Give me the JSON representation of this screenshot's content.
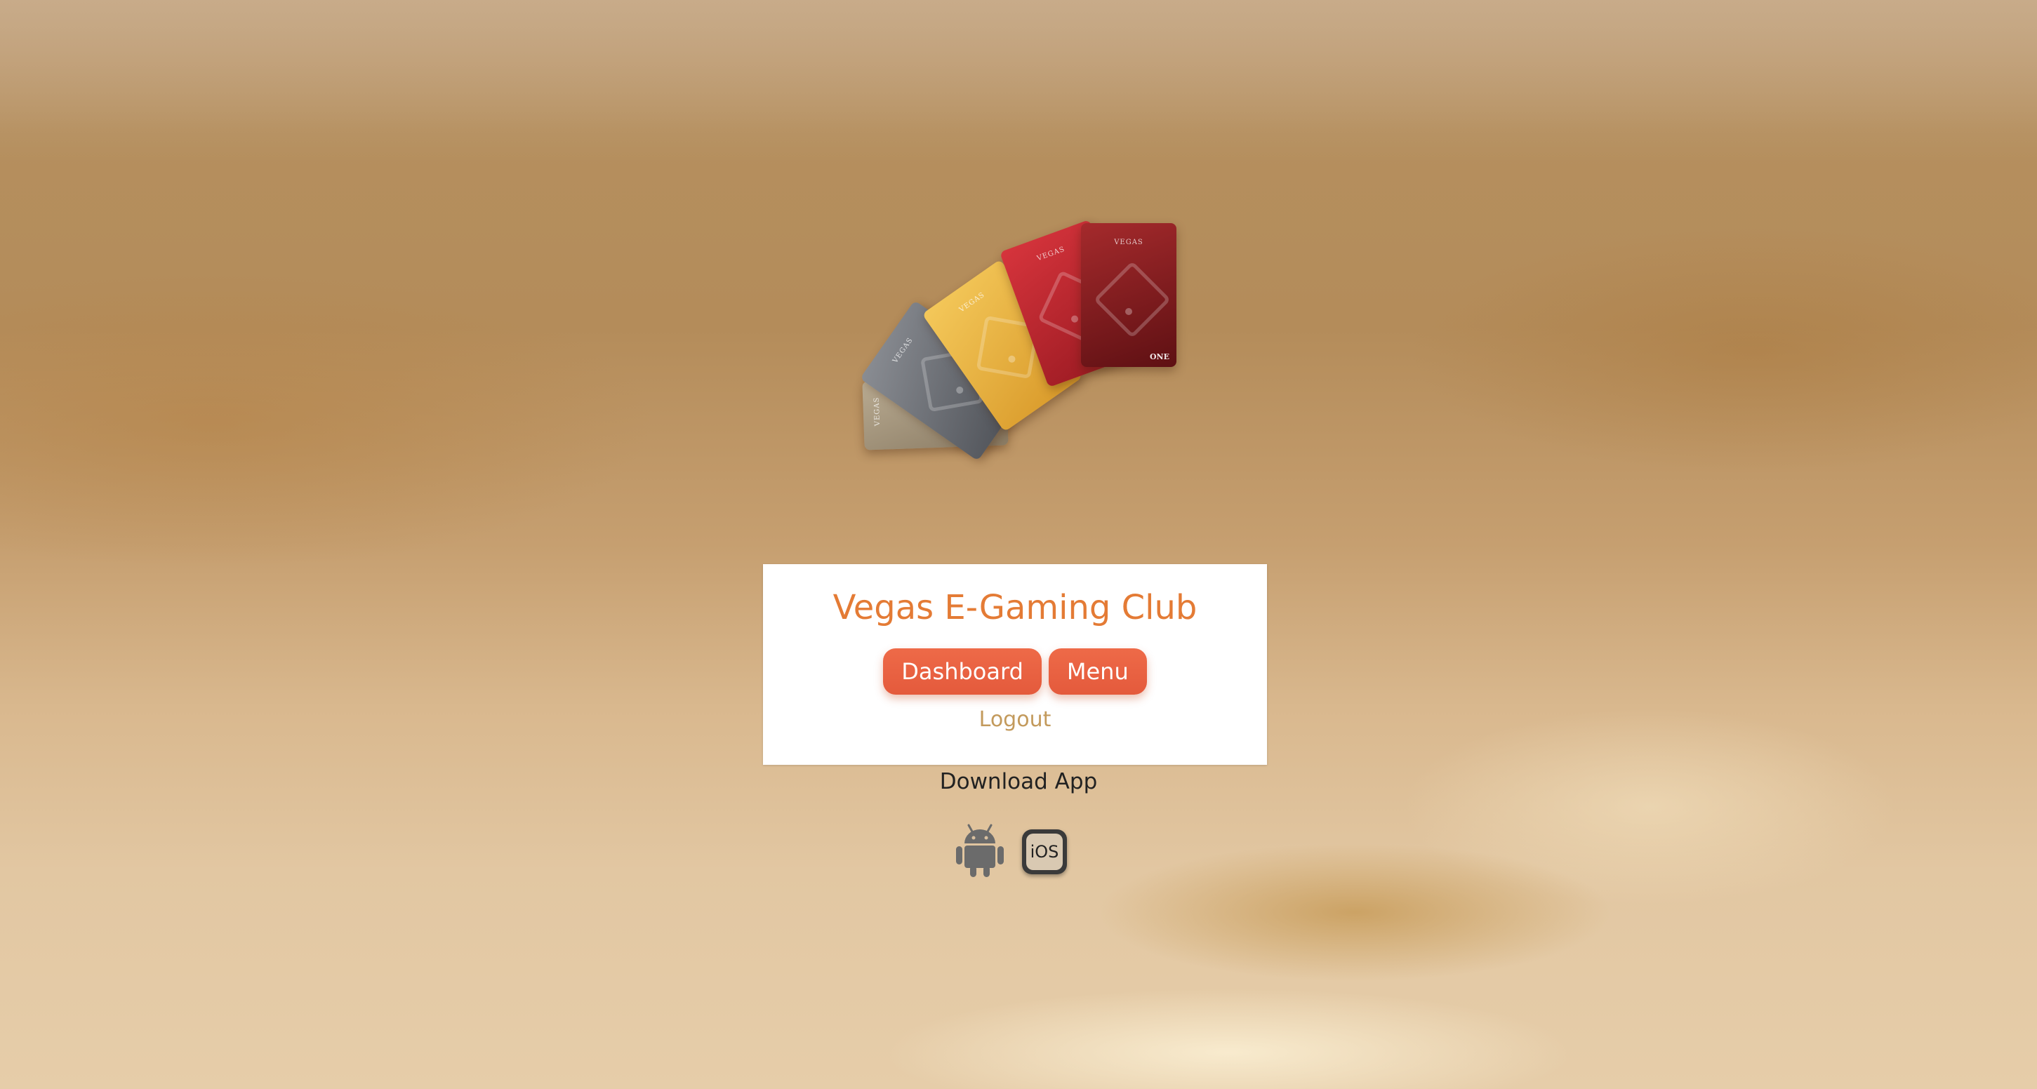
{
  "header": {
    "title": "Vegas E-Gaming Club"
  },
  "cards": {
    "brand": "VEGAS",
    "mark": "ONE"
  },
  "actions": {
    "dashboard_label": "Dashboard",
    "menu_label": "Menu",
    "logout_label": "Logout"
  },
  "download": {
    "label": "Download App",
    "ios_label": "iOS",
    "android_icon": "android-icon",
    "ios_icon": "ios-icon"
  },
  "colors": {
    "title": "#e47b35",
    "button": "#e45a3c",
    "logout": "#c39a5c"
  }
}
